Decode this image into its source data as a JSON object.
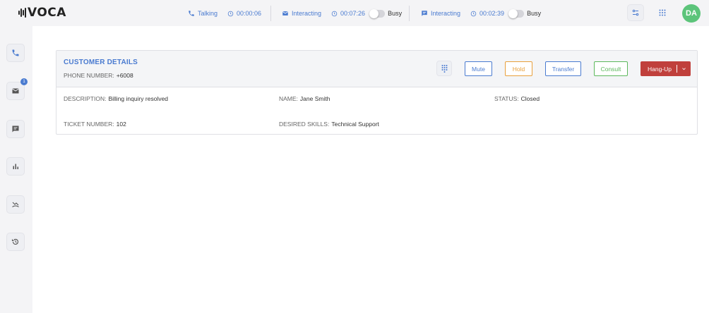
{
  "app": {
    "logo_text": "VOCA"
  },
  "sessions": [
    {
      "status": "Talking",
      "timer": "00:00:06",
      "icon": "phone-icon"
    },
    {
      "status": "Interacting",
      "timer": "00:07:26",
      "state": "Busy",
      "icon": "mail-icon"
    },
    {
      "status": "Interacting",
      "timer": "00:02:39",
      "state": "Busy",
      "icon": "chat-icon"
    }
  ],
  "user": {
    "initials": "DA",
    "avatar_color": "#5cc47a"
  },
  "sidebar": {
    "items": [
      {
        "name": "phone"
      },
      {
        "name": "mail",
        "badge": "1"
      },
      {
        "name": "chat"
      },
      {
        "name": "stats"
      },
      {
        "name": "missed-calls"
      },
      {
        "name": "history"
      }
    ]
  },
  "customer": {
    "title": "CUSTOMER DETAILS",
    "phone_label": "PHONE NUMBER:",
    "phone_value": "+6008",
    "description_label": "DESCRIPTION:",
    "description_value": "Billing inquiry resolved",
    "name_label": "NAME:",
    "name_value": "Jane Smith",
    "status_label": "STATUS:",
    "status_value": "Closed",
    "ticket_label": "TICKET NUMBER:",
    "ticket_value": "102",
    "skills_label": "DESIRED SKILLS:",
    "skills_value": "Technical Support"
  },
  "actions": {
    "mute": "Mute",
    "hold": "Hold",
    "transfer": "Transfer",
    "consult": "Consult",
    "hangup": "Hang-Up"
  },
  "colors": {
    "accent": "#4a7bd0",
    "hold": "#e8a03c",
    "consult": "#5cb85c",
    "hangup": "#c0403c"
  }
}
